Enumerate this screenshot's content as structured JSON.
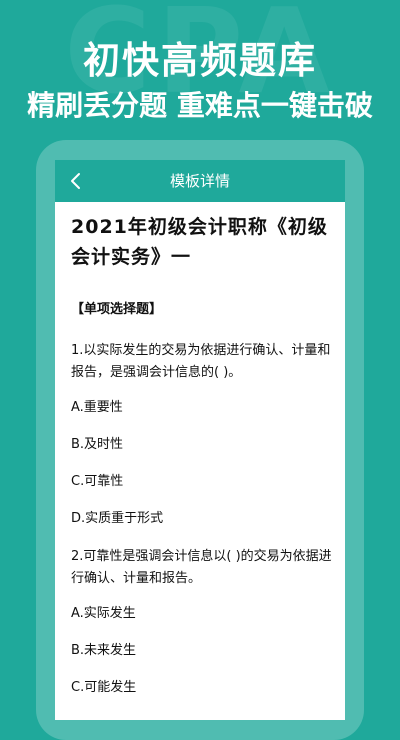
{
  "background": {
    "watermark": "CPA",
    "color": "#1fa99b"
  },
  "hero": {
    "line1": "初快高频题库",
    "line2": "精刷丢分题 重难点一键击破"
  },
  "navbar": {
    "title": "模板详情",
    "back_icon": "chevron-left-icon"
  },
  "document": {
    "title": "2021年初级会计职称《初级会计实务》一",
    "section": "【单项选择题】",
    "questions": [
      {
        "text": "1.以实际发生的交易为依据进行确认、计量和报告，是强调会计信息的( )。",
        "options": [
          "A.重要性",
          "B.及时性",
          "C.可靠性",
          "D.实质重于形式"
        ]
      },
      {
        "text": "2.可靠性是强调会计信息以( )的交易为依据进行确认、计量和报告。",
        "options": [
          "A.实际发生",
          "B.未来发生",
          "C.可能发生"
        ]
      }
    ]
  }
}
